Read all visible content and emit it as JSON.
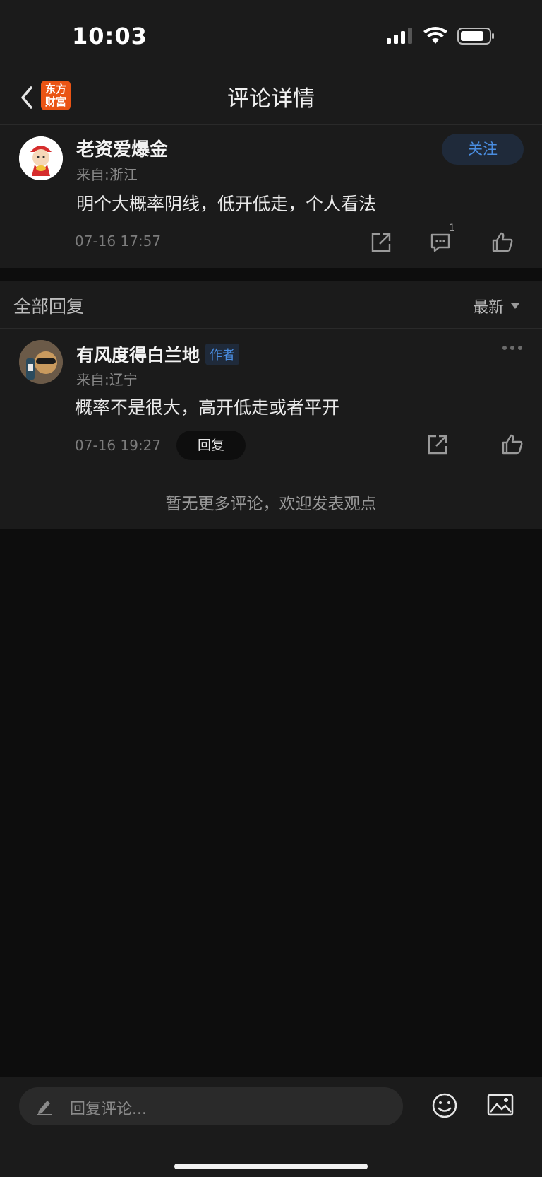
{
  "status": {
    "time": "10:03"
  },
  "nav": {
    "title": "评论详情",
    "logo_line1": "东方",
    "logo_line2": "财富"
  },
  "post": {
    "username": "老资爱爆金",
    "location": "来自:浙江",
    "follow_label": "关注",
    "content": "明个大概率阴线，低开低走，个人看法",
    "timestamp": "07-16 17:57",
    "comment_count": "1"
  },
  "section": {
    "title": "全部回复",
    "sort_label": "最新"
  },
  "reply": {
    "username": "有风度得白兰地",
    "badge": "作者",
    "location": "来自:辽宁",
    "content": "概率不是很大，高开低走或者平开",
    "timestamp": "07-16 19:27",
    "reply_label": "回复"
  },
  "empty_hint": "暂无更多评论，欢迎发表观点",
  "composer": {
    "placeholder": "回复评论..."
  }
}
